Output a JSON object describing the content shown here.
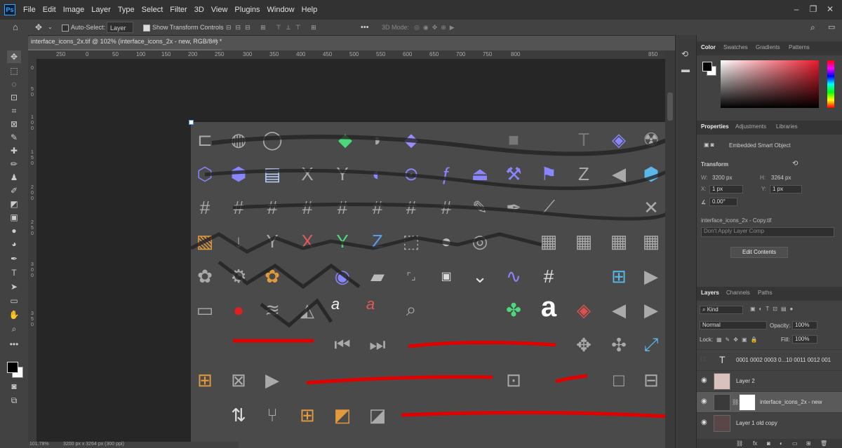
{
  "menu": [
    "File",
    "Edit",
    "Image",
    "Layer",
    "Type",
    "Select",
    "Filter",
    "3D",
    "View",
    "Plugins",
    "Window",
    "Help"
  ],
  "app_logo": "Ps",
  "options": {
    "auto_select_label": "Auto-Select:",
    "auto_select_value": "Layer",
    "transform_label": "Show Transform Controls",
    "mode_3d": "3D Mode:",
    "more": "•••"
  },
  "document": {
    "tab_title": "interface_icons_2x.tif @ 102% (interface_icons_2x - new, RGB/8#) *",
    "close": "×",
    "ruler_top": [
      "250",
      "0",
      "50",
      "100",
      "150",
      "200",
      "250",
      "300",
      "350",
      "400",
      "450",
      "500",
      "550",
      "600",
      "650",
      "700",
      "750",
      "800",
      "850"
    ],
    "ruler_left": [
      "0",
      "5",
      "0",
      "1",
      "0",
      "0",
      "1",
      "5",
      "0",
      "2",
      "0",
      "0",
      "2",
      "5",
      "0",
      "3",
      "0",
      "0",
      "3",
      "5",
      "0"
    ],
    "status_zoom": "101.78%",
    "status_size": "3200 px x 3264 px (300 ppi)"
  },
  "color_panel": {
    "tabs": [
      "Color",
      "Swatches",
      "Gradients",
      "Patterns"
    ],
    "fg": "#000000",
    "bg": "#ffffff",
    "hue_color": "#e81b2c"
  },
  "properties": {
    "tabs": [
      "Properties",
      "Adjustments",
      "Libraries"
    ],
    "type": "Embedded Smart Object",
    "section": "Transform",
    "w_label": "W:",
    "w": "3200 px",
    "h_label": "H:",
    "h": "3264 px",
    "x_label": "X:",
    "x": "1 px",
    "y_label": "Y:",
    "y": "1 px",
    "angle": "0.00°",
    "file": "interface_icons_2x - Copy.tif",
    "comp": "Don't Apply Layer Comp",
    "edit_button": "Edit Contents"
  },
  "layers_panel": {
    "tabs": [
      "Layers",
      "Channels",
      "Paths"
    ],
    "filter": "Kind",
    "blend": "Normal",
    "opacity_label": "Opacity:",
    "opacity": "100%",
    "lock_label": "Lock:",
    "fill_label": "Fill:",
    "fill": "100%",
    "layers": [
      {
        "name": "0001 0002 0003 0...10 0011 0012 001",
        "kind": "text",
        "visible": false
      },
      {
        "name": "Layer 2",
        "kind": "pixel",
        "visible": true
      },
      {
        "name": "interface_icons_2x - new",
        "kind": "smart",
        "visible": true,
        "selected": true
      },
      {
        "name": "Layer 1 old copy",
        "kind": "pixel",
        "visible": true
      }
    ],
    "footer_icons": [
      "link-icon",
      "fx-icon",
      "mask-icon",
      "adjustment-icon",
      "group-icon",
      "new-layer-icon",
      "trash-icon"
    ]
  },
  "canvas_letters": {
    "a1": "a",
    "a2": "a",
    "a3": "a"
  }
}
